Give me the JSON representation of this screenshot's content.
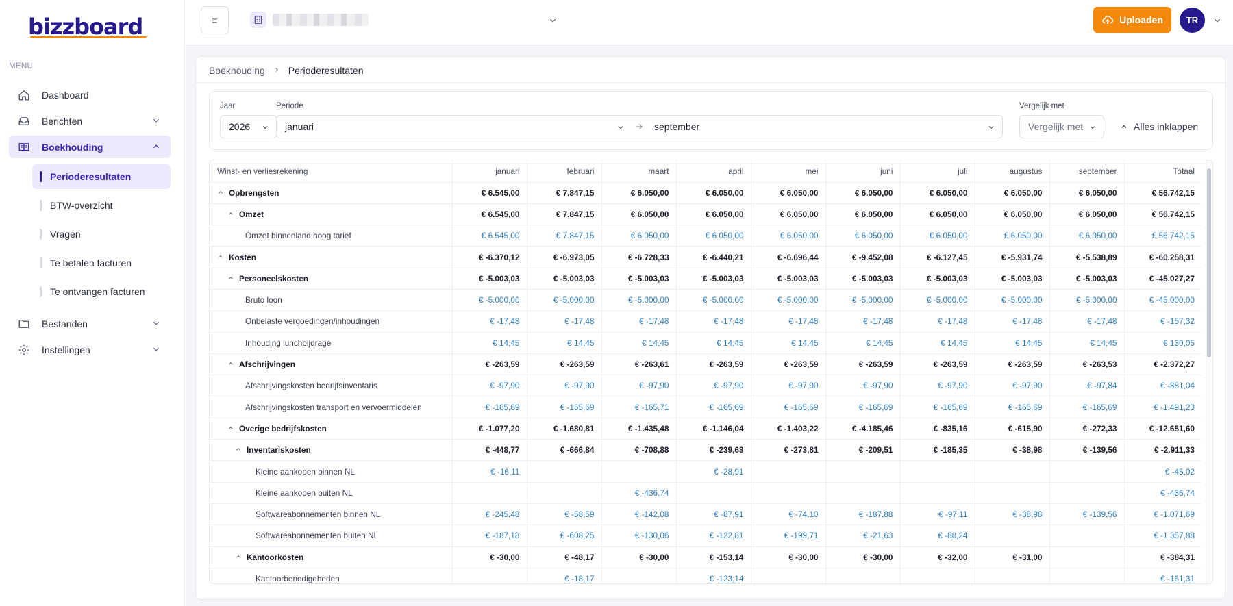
{
  "logo_text": "bizzboard",
  "sidebar": {
    "menu_label": "MENU",
    "items": [
      {
        "label": "Dashboard"
      },
      {
        "label": "Berichten"
      },
      {
        "label": "Boekhouding"
      },
      {
        "label": "Bestanden"
      },
      {
        "label": "Instellingen"
      }
    ],
    "sub_items": [
      {
        "label": "Perioderesultaten"
      },
      {
        "label": "BTW-overzicht"
      },
      {
        "label": "Vragen"
      },
      {
        "label": "Te betalen facturen"
      },
      {
        "label": "Te ontvangen facturen"
      }
    ]
  },
  "topbar": {
    "menu_glyph": "≡",
    "upload_label": "Uploaden",
    "avatar_initials": "TR"
  },
  "breadcrumb": {
    "parent": "Boekhouding",
    "current": "Perioderesultaten"
  },
  "filters": {
    "year_label": "Jaar",
    "year_value": "2026",
    "period_label": "Periode",
    "period_from": "januari",
    "period_to": "september",
    "compare_label": "Vergelijk met",
    "compare_placeholder": "Vergelijk met",
    "collapse_all": "Alles inklappen"
  },
  "table": {
    "headers": [
      "Winst- en verliesrekening",
      "januari",
      "februari",
      "maart",
      "april",
      "mei",
      "juni",
      "juli",
      "augustus",
      "september",
      "Totaal"
    ],
    "rows": [
      {
        "label": "Opbrengsten",
        "level": 0,
        "bold": true,
        "values": [
          "€ 6.545,00",
          "€ 7.847,15",
          "€ 6.050,00",
          "€ 6.050,00",
          "€ 6.050,00",
          "€ 6.050,00",
          "€ 6.050,00",
          "€ 6.050,00",
          "€ 6.050,00",
          "€ 56.742,15"
        ]
      },
      {
        "label": "Omzet",
        "level": 1,
        "bold": true,
        "values": [
          "€ 6.545,00",
          "€ 7.847,15",
          "€ 6.050,00",
          "€ 6.050,00",
          "€ 6.050,00",
          "€ 6.050,00",
          "€ 6.050,00",
          "€ 6.050,00",
          "€ 6.050,00",
          "€ 56.742,15"
        ]
      },
      {
        "label": "Omzet binnenland hoog tarief",
        "level": 2,
        "bold": false,
        "values": [
          "€ 6.545,00",
          "€ 7.847,15",
          "€ 6.050,00",
          "€ 6.050,00",
          "€ 6.050,00",
          "€ 6.050,00",
          "€ 6.050,00",
          "€ 6.050,00",
          "€ 6.050,00",
          "€ 56.742,15"
        ]
      },
      {
        "label": "Kosten",
        "level": 0,
        "bold": true,
        "values": [
          "€ -6.370,12",
          "€ -6.973,05",
          "€ -6.728,33",
          "€ -6.440,21",
          "€ -6.696,44",
          "€ -9.452,08",
          "€ -6.127,45",
          "€ -5.931,74",
          "€ -5.538,89",
          "€ -60.258,31"
        ]
      },
      {
        "label": "Personeelskosten",
        "level": 1,
        "bold": true,
        "values": [
          "€ -5.003,03",
          "€ -5.003,03",
          "€ -5.003,03",
          "€ -5.003,03",
          "€ -5.003,03",
          "€ -5.003,03",
          "€ -5.003,03",
          "€ -5.003,03",
          "€ -5.003,03",
          "€ -45.027,27"
        ]
      },
      {
        "label": "Bruto loon",
        "level": 2,
        "bold": false,
        "values": [
          "€ -5.000,00",
          "€ -5.000,00",
          "€ -5.000,00",
          "€ -5.000,00",
          "€ -5.000,00",
          "€ -5.000,00",
          "€ -5.000,00",
          "€ -5.000,00",
          "€ -5.000,00",
          "€ -45.000,00"
        ]
      },
      {
        "label": "Onbelaste vergoedingen/inhoudingen",
        "level": 2,
        "bold": false,
        "values": [
          "€ -17,48",
          "€ -17,48",
          "€ -17,48",
          "€ -17,48",
          "€ -17,48",
          "€ -17,48",
          "€ -17,48",
          "€ -17,48",
          "€ -17,48",
          "€ -157,32"
        ]
      },
      {
        "label": "Inhouding lunchbijdrage",
        "level": 2,
        "bold": false,
        "values": [
          "€ 14,45",
          "€ 14,45",
          "€ 14,45",
          "€ 14,45",
          "€ 14,45",
          "€ 14,45",
          "€ 14,45",
          "€ 14,45",
          "€ 14,45",
          "€ 130,05"
        ]
      },
      {
        "label": "Afschrijvingen",
        "level": 1,
        "bold": true,
        "values": [
          "€ -263,59",
          "€ -263,59",
          "€ -263,61",
          "€ -263,59",
          "€ -263,59",
          "€ -263,59",
          "€ -263,59",
          "€ -263,59",
          "€ -263,53",
          "€ -2.372,27"
        ]
      },
      {
        "label": "Afschrijvingskosten bedrijfsinventaris",
        "level": 2,
        "bold": false,
        "values": [
          "€ -97,90",
          "€ -97,90",
          "€ -97,90",
          "€ -97,90",
          "€ -97,90",
          "€ -97,90",
          "€ -97,90",
          "€ -97,90",
          "€ -97,84",
          "€ -881,04"
        ]
      },
      {
        "label": "Afschrijvingskosten transport en vervoermiddelen",
        "level": 2,
        "bold": false,
        "values": [
          "€ -165,69",
          "€ -165,69",
          "€ -165,71",
          "€ -165,69",
          "€ -165,69",
          "€ -165,69",
          "€ -165,69",
          "€ -165,69",
          "€ -165,69",
          "€ -1.491,23"
        ]
      },
      {
        "label": "Overige bedrijfskosten",
        "level": 1,
        "bold": true,
        "values": [
          "€ -1.077,20",
          "€ -1.680,81",
          "€ -1.435,48",
          "€ -1.146,04",
          "€ -1.403,22",
          "€ -4.185,46",
          "€ -835,16",
          "€ -615,90",
          "€ -272,33",
          "€ -12.651,60"
        ]
      },
      {
        "label": "Inventariskosten",
        "level": 2,
        "bold": true,
        "values": [
          "€ -448,77",
          "€ -666,84",
          "€ -708,88",
          "€ -239,63",
          "€ -273,81",
          "€ -209,51",
          "€ -185,35",
          "€ -38,98",
          "€ -139,56",
          "€ -2.911,33"
        ]
      },
      {
        "label": "Kleine aankopen binnen NL",
        "level": 3,
        "bold": false,
        "values": [
          "€ -16,11",
          "",
          "",
          "€ -28,91",
          "",
          "",
          "",
          "",
          "",
          "€ -45,02"
        ]
      },
      {
        "label": "Kleine aankopen buiten NL",
        "level": 3,
        "bold": false,
        "values": [
          "",
          "",
          "€ -436,74",
          "",
          "",
          "",
          "",
          "",
          "",
          "€ -436,74"
        ]
      },
      {
        "label": "Softwareabonnementen binnen NL",
        "level": 3,
        "bold": false,
        "values": [
          "€ -245,48",
          "€ -58,59",
          "€ -142,08",
          "€ -87,91",
          "€ -74,10",
          "€ -187,88",
          "€ -97,11",
          "€ -38,98",
          "€ -139,56",
          "€ -1.071,69"
        ]
      },
      {
        "label": "Softwareabonnementen buiten NL",
        "level": 3,
        "bold": false,
        "values": [
          "€ -187,18",
          "€ -608,25",
          "€ -130,06",
          "€ -122,81",
          "€ -199,71",
          "€ -21,63",
          "€ -88,24",
          "",
          "",
          "€ -1.357,88"
        ]
      },
      {
        "label": "Kantoorkosten",
        "level": 2,
        "bold": true,
        "values": [
          "€ -30,00",
          "€ -48,17",
          "€ -30,00",
          "€ -153,14",
          "€ -30,00",
          "€ -30,00",
          "€ -32,00",
          "€ -31,00",
          "",
          "€ -384,31"
        ]
      },
      {
        "label": "Kantoorbenodigdheden",
        "level": 3,
        "bold": false,
        "values": [
          "",
          "€ -18,17",
          "",
          "€ -123,14",
          "",
          "",
          "",
          "",
          "",
          "€ -161,31"
        ]
      }
    ]
  },
  "colors": {
    "brand_navy": "#261a8c",
    "brand_orange": "#f5890c",
    "detail_value": "#2d7fc0",
    "active_bg": "#ece9fd"
  }
}
